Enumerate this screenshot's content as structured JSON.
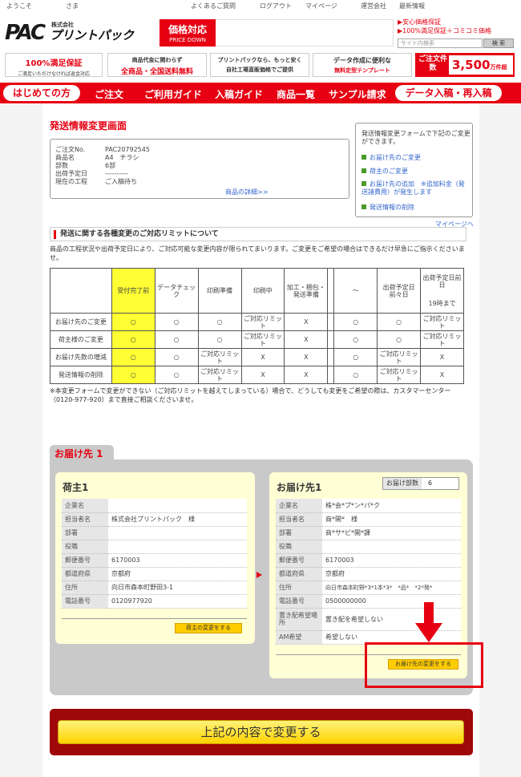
{
  "topbar": {
    "welcome": "ようこそ",
    "sama": "さま",
    "links": [
      "よくあるご質問",
      "ログアウト",
      "マイページ"
    ],
    "right": [
      "運営会社",
      "最新情報"
    ]
  },
  "header": {
    "logo_pac": "PAC",
    "logo_corp": "株式会社",
    "logo_name": "プリントパック",
    "price_title": "価格対応",
    "price_sub": "PRICE DOWN",
    "links": [
      "▶安心価格保証",
      "▶100%満足保証＋コミコミ価格"
    ],
    "search_placeholder": "サイト内検索",
    "search_button": "検 索"
  },
  "banners": [
    {
      "l1": "100%満足保証",
      "l2": "ご満足いただけなければ返金対応"
    },
    {
      "l1": "商品代金に関わらず",
      "l2": "全商品・全国送料無料"
    },
    {
      "l1": "プリントパックなら、もっと安く",
      "l2": "自社工場直販価格でご提供"
    },
    {
      "l1": "データ作成に便利な",
      "l2": "無料定型テンプレート"
    }
  ],
  "order_count": {
    "label": "ご注文件 数",
    "value": "3,500",
    "unit": "万件超"
  },
  "nav": {
    "first": "はじめての方",
    "items": [
      "ご注文",
      "ご利用ガイド",
      "入稿ガイド",
      "商品一覧",
      "サンプル請求"
    ],
    "last": "データ入稿・再入稿"
  },
  "page_title": "発送情報変更画面",
  "order_info": {
    "rows": [
      {
        "k": "ご注文No.",
        "v": "PAC20792545"
      },
      {
        "k": "商品名",
        "v": "A4　チラシ"
      },
      {
        "k": "部数",
        "v": "6部"
      },
      {
        "k": "出荷予定日",
        "v": "----------"
      },
      {
        "k": "現在の工程",
        "v": "ご入稿待ち"
      }
    ],
    "detail_link": "商品の詳細>>"
  },
  "sidebox": {
    "intro": "発送情報変更フォームで下記のご変更ができます。",
    "links": [
      "お届け先のご変更",
      "荷主のご変更",
      "お届け先の追加　※追加料金（発送諸費用）が発生します",
      "発送情報の削除"
    ]
  },
  "mypage_link": "マイページへ",
  "limit_section": {
    "title": "発送に関する各種変更のご対応リミットについて",
    "note": "商品の工程状況や出荷予定日により、ご対応可能な変更内容が限られてまいります。ご変更をご希望の場合はできるだけ早急にご指示くださいませ。",
    "headers": [
      "受付完了前",
      "データチェック",
      "印刷準備",
      "印刷中",
      "加工・梱包・発送準備",
      "～",
      "出荷予定日前々日",
      "出荷予定日前日"
    ],
    "last_header_sub": "19時まで",
    "rows": [
      {
        "label": "お届け先のご変更",
        "cells": [
          "○",
          "○",
          "○",
          "ご対応リミット",
          "X",
          "○",
          "○",
          "ご対応リミット"
        ]
      },
      {
        "label": "荷主様のご変更",
        "cells": [
          "○",
          "○",
          "○",
          "ご対応リミット",
          "X",
          "○",
          "○",
          "ご対応リミット"
        ]
      },
      {
        "label": "お届け先数の増減",
        "cells": [
          "○",
          "○",
          "ご対応リミット",
          "X",
          "X",
          "○",
          "ご対応リミット",
          "X"
        ]
      },
      {
        "label": "発送情報の削除",
        "cells": [
          "○",
          "○",
          "ご対応リミット",
          "X",
          "X",
          "○",
          "ご対応リミット",
          "X"
        ]
      }
    ],
    "footer_note": "※本変更フォームで変更ができない（ご対応リミットを越えてしまっている）場合で、どうしても変更をご希望の際は、カスタマーセンター（0120-977-920）まで直接ご相談くださいませ。"
  },
  "delivery": {
    "tab": "お届け先 1",
    "shipper": {
      "title": "荷主1",
      "rows": [
        {
          "k": "企業名",
          "v": ""
        },
        {
          "k": "担当者名",
          "v": "株式会社プリントパック　様"
        },
        {
          "k": "部署",
          "v": ""
        },
        {
          "k": "役職",
          "v": ""
        },
        {
          "k": "郵便番号",
          "v": "6170003"
        },
        {
          "k": "都道府県",
          "v": "京都府"
        },
        {
          "k": "住所",
          "v": "向日市森本町野田3-1"
        },
        {
          "k": "電話番号",
          "v": "0120977920"
        }
      ],
      "button": "荷主の変更をする"
    },
    "recipient": {
      "title": "お届け先1",
      "count_label": "お届け部数",
      "count_value": "6",
      "rows": [
        {
          "k": "企業名",
          "v": "株*会*プ*ン*パ*ク"
        },
        {
          "k": "担当者名",
          "v": "商*開*　様"
        },
        {
          "k": "部署",
          "v": "商*サ*ビ*開*課"
        },
        {
          "k": "役職",
          "v": ""
        },
        {
          "k": "郵便番号",
          "v": "6170003"
        },
        {
          "k": "都道府県",
          "v": "京都府"
        },
        {
          "k": "住所",
          "v": "向日市森本町野*3*1本*3*　*品*　*2*発*"
        },
        {
          "k": "電話番号",
          "v": "0500000000"
        },
        {
          "k": "置き配希望場所",
          "v": "置き配を希望しない"
        },
        {
          "k": "AM希望",
          "v": "希望しない"
        }
      ],
      "button": "お届け先の変更をする"
    }
  },
  "submit_label": "上記の内容で変更する",
  "colors": {
    "brand_red": "#e60012",
    "yellow": "#ffff33",
    "button_yellow": "#ffcc00"
  }
}
